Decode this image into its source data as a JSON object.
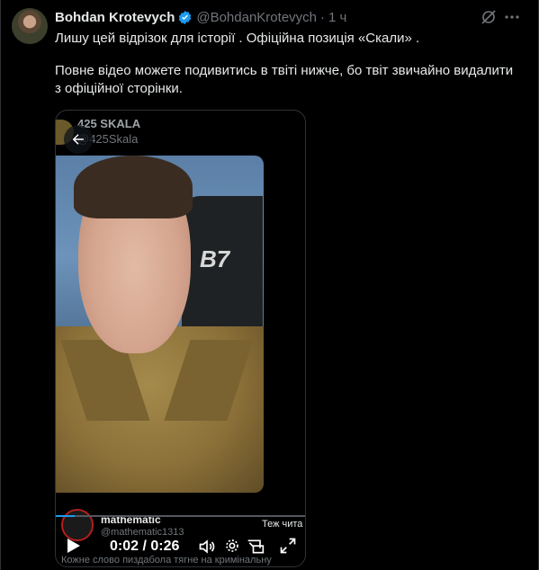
{
  "tweet": {
    "author_name": "Bohdan Krotevych",
    "handle": "@BohdanKrotevych",
    "separator": "·",
    "time": "1 ч",
    "text_lines": [
      "Лишу цей відрізок для історії . Офіційна позиція «Скали» .",
      "Повне відео можете подивитись в твіті нижче, бо твіт звичайно видалити з офіційної сторінки."
    ]
  },
  "media": {
    "inner_account_name": "425 SKALA",
    "inner_account_handle": "@425Skala",
    "chair_logo_text": "B7",
    "caption_name": "mathematic",
    "caption_handle": "@mathematic1313",
    "caption_side": "Теж чита",
    "time_display": "0:02 / 0:26",
    "progress": 0.077,
    "subtitle": "Кожне слово пиздабола тягне на кримінальну"
  },
  "colors": {
    "accent": "#1d9bf0",
    "background": "#000000",
    "text": "#e7e9ea",
    "muted": "#71767b"
  },
  "icons": [
    "verified-badge-icon",
    "grok-icon",
    "more-icon",
    "back-arrow-icon",
    "play-icon",
    "volume-icon",
    "settings-icon",
    "picture-in-picture-icon",
    "fullscreen-icon"
  ]
}
